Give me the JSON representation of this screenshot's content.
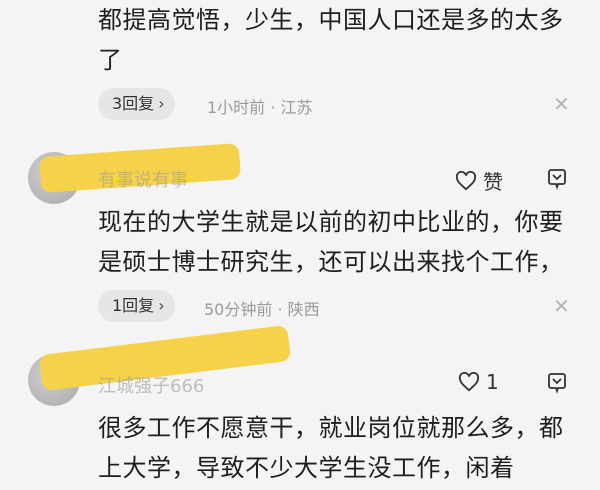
{
  "comments": [
    {
      "text_line1": "都提高觉悟，少生，中国人口还是多的太多",
      "text_line2": "了",
      "reply_label": "3回复",
      "meta": "1小时前 · 江苏"
    },
    {
      "username": "有事说有事",
      "like_label": "赞",
      "text_line1": "现在的大学生就是以前的初中比业的，你要",
      "text_line2": "是硕士博士研究生，还可以出来找个工作，",
      "reply_label": "1回复",
      "meta": "50分钟前 · 陕西"
    },
    {
      "username": "江城强子666",
      "like_count": "1",
      "text_line1": "很多工作不愿意干，就业岗位就那么多，都",
      "text_line2": "上大学，导致不少大学生没工作，闲着"
    }
  ],
  "icons": {
    "chevron": "›",
    "close": "✕",
    "heart": "♡"
  },
  "colors": {
    "highlight": "#f6d24a"
  }
}
